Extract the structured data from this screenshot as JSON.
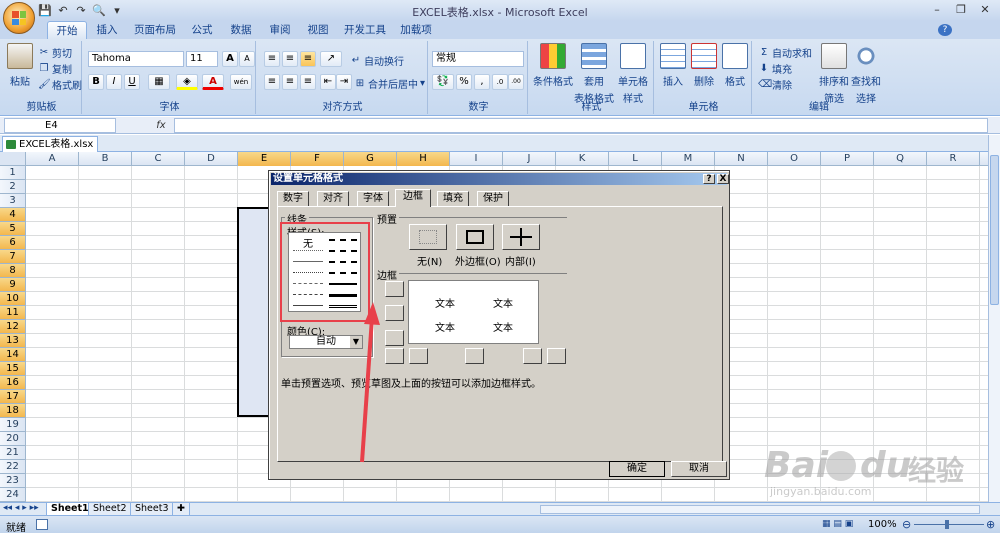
{
  "window": {
    "title": "EXCEL表格.xlsx - Microsoft Excel",
    "minimize": "–",
    "restore": "❐",
    "close": "✕"
  },
  "qat": {
    "save_icon": "💾",
    "undo": "↶",
    "redo": "↷",
    "print_preview": "🔍",
    "customize": "▾"
  },
  "ribbon_tabs": [
    "开始",
    "插入",
    "页面布局",
    "公式",
    "数据",
    "审阅",
    "视图",
    "开发工具",
    "加载项"
  ],
  "active_tab": "开始",
  "ribbon_help": "?",
  "clipboard": {
    "group": "剪贴板",
    "paste": "粘贴",
    "cut": "剪切",
    "copy": "复制",
    "format_painter": "格式刷"
  },
  "font": {
    "group": "字体",
    "name": "Tahoma",
    "size": "11",
    "grow": "A",
    "shrink": "A",
    "bold": "B",
    "italic": "I",
    "underline": "U",
    "font_color_letter": "A",
    "phonetic": "wén"
  },
  "alignment": {
    "group": "对齐方式",
    "wrap": "自动换行",
    "merge": "合并后居中"
  },
  "number": {
    "group": "数字",
    "format": "常规",
    "percent": "%",
    "comma": ",",
    "inc_dec": ".0",
    "dec_dec": ".00"
  },
  "styles": {
    "group": "样式",
    "conditional": "条件格式",
    "table_line1": "套用",
    "table_line2": "表格格式",
    "cell_line1": "单元格",
    "cell_line2": "样式"
  },
  "cells": {
    "group": "单元格",
    "insert": "插入",
    "delete": "删除",
    "format": "格式"
  },
  "editing": {
    "group": "编辑",
    "autosum": "自动求和",
    "fill": "填充",
    "clear": "清除",
    "sort_line1": "排序和",
    "sort_line2": "筛选",
    "find_line1": "查找和",
    "find_line2": "选择"
  },
  "formula_bar": {
    "name_box": "E4",
    "fx": "fx",
    "value": ""
  },
  "doc_tab": "EXCEL表格.xlsx",
  "columns": [
    "A",
    "B",
    "C",
    "D",
    "E",
    "F",
    "G",
    "H",
    "I",
    "J",
    "K",
    "L",
    "M",
    "N",
    "O",
    "P",
    "Q",
    "R"
  ],
  "rows": [
    "1",
    "2",
    "3",
    "4",
    "5",
    "6",
    "7",
    "8",
    "9",
    "10",
    "11",
    "12",
    "13",
    "14",
    "15",
    "16",
    "17",
    "18",
    "19",
    "20",
    "21",
    "22",
    "23",
    "24"
  ],
  "selected_columns": [
    "E",
    "F",
    "G",
    "H"
  ],
  "selected_rows": [
    "4",
    "5",
    "6",
    "7",
    "8",
    "9",
    "10",
    "11",
    "12",
    "13",
    "14",
    "15",
    "16",
    "17",
    "18"
  ],
  "sheets": [
    "Sheet1",
    "Sheet2",
    "Sheet3"
  ],
  "status": {
    "mode": "就绪",
    "zoom": "100%"
  },
  "dialog": {
    "title": "设置单元格格式",
    "help": "?",
    "close": "X",
    "tabs": [
      "数字",
      "对齐",
      "字体",
      "边框",
      "填充",
      "保护"
    ],
    "active_tab": "边框",
    "line_group": "线条",
    "style_label": "样式(S):",
    "style_none": "无",
    "color_label": "颜色(C):",
    "color_value": "自动",
    "presets_label": "预置",
    "preset_none": "无(N)",
    "preset_outline": "外边框(O)",
    "preset_inside": "内部(I)",
    "border_label": "边框",
    "preview_text": [
      "文本",
      "文本",
      "文本",
      "文本"
    ],
    "hint": "单击预置选项、预览草图及上面的按钮可以添加边框样式。",
    "ok": "确定",
    "cancel": "取消"
  },
  "watermark": {
    "brand": "Bai",
    "brand2": "du",
    "cn": "经验",
    "url": "jingyan.baidu.com"
  },
  "colors": {
    "accent_red": "#e8404a",
    "selected_header": "#f3b74e",
    "ribbon_bg": "#c7d9f0",
    "dialog_bg": "#d4d0c8"
  }
}
